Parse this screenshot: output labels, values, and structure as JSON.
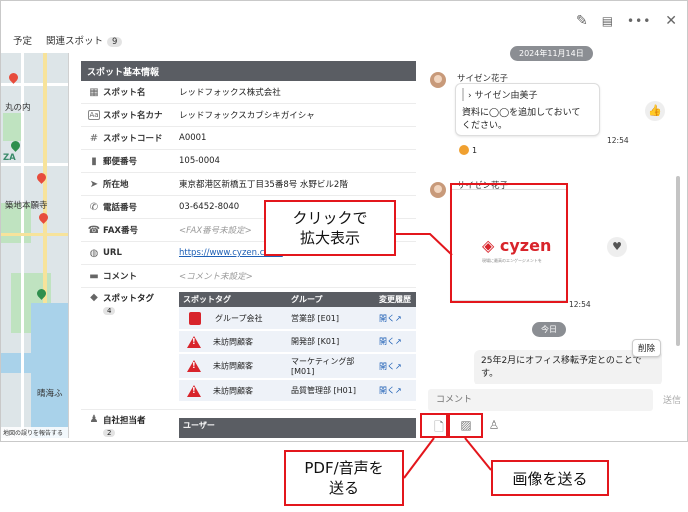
{
  "tabs": {
    "schedule": "予定",
    "related_spots": "関連スポット",
    "related_count": "9"
  },
  "map": {
    "labels": [
      "丸の内",
      "ZA",
      "築地本願寺",
      "晴海ふ"
    ],
    "report_error": "地図の誤りを報告する",
    "colors": {
      "land": "#e9eef0",
      "park": "#bfe3c0",
      "water": "#a9d2ea"
    }
  },
  "info": {
    "header": "スポット基本情報",
    "rows": [
      {
        "icon": "building-icon",
        "label": "スポット名",
        "value": "レッドフォックス株式会社"
      },
      {
        "icon": "kana-icon",
        "label": "スポット名カナ",
        "value": "レッドフォックスカブシキガイシャ"
      },
      {
        "icon": "hash-icon",
        "label": "スポットコード",
        "value": "A0001"
      },
      {
        "icon": "mailbox-icon",
        "label": "郵便番号",
        "value": "105-0004"
      },
      {
        "icon": "location-arrow-icon",
        "label": "所在地",
        "value": "東京都港区新橋五丁目35番8号 水野ビル2階"
      },
      {
        "icon": "phone-icon",
        "label": "電話番号",
        "value": "03-6452-8040"
      },
      {
        "icon": "fax-icon",
        "label": "FAX番号",
        "value": "<FAX番号未設定>"
      },
      {
        "icon": "globe-icon",
        "label": "URL",
        "value": "https://www.cyzen.cloud"
      },
      {
        "icon": "comment-icon",
        "label": "コメント",
        "value": "<コメント未設定>"
      }
    ],
    "tags": {
      "label": "スポットタグ",
      "count": "4",
      "headers": [
        "スポットタグ",
        "グループ",
        "変更履歴"
      ],
      "rows": [
        {
          "icon": "brand-icon",
          "tag": "グループ会社",
          "group": "営業部 [E01]",
          "link": "開く↗"
        },
        {
          "icon": "warning-icon",
          "tag": "未訪問顧客",
          "group": "開発部 [K01]",
          "link": "開く↗"
        },
        {
          "icon": "warning-icon",
          "tag": "未訪問顧客",
          "group": "マーケティング部 [M01]",
          "link": "開く↗"
        },
        {
          "icon": "warning-icon",
          "tag": "未訪問顧客",
          "group": "品質管理部 [H01]",
          "link": "開く↗"
        }
      ]
    },
    "owner": {
      "label": "自社担当者",
      "count": "2",
      "header": "ユーザー"
    }
  },
  "header_icons": [
    "pencil-icon",
    "chat-icon",
    "more-icon",
    "close-icon"
  ],
  "chat": {
    "date1": "2024年11月14日",
    "msg1": {
      "sender": "サイゼン花子",
      "quote": "サイゼン由美子",
      "text_line1": "資料に◯◯を追加しておいて",
      "text_line2": "ください。",
      "time": "12:54",
      "reaction_count": "1"
    },
    "msg2": {
      "sender": "サイゼン花子",
      "logo": "cyzen",
      "logo_sub": "現場に最高のエンゲージメントを",
      "time": "12:54"
    },
    "date2": "今日",
    "msg3": {
      "text_line1": "25年2月にオフィス移転予定とのことで",
      "text_line2": "す。",
      "delete_label": "削除"
    }
  },
  "composer": {
    "placeholder": "コメント",
    "send": "送信"
  },
  "callouts": {
    "enlarge_line1": "クリックで",
    "enlarge_line2": "拡大表示",
    "pdf_line1": "PDF/音声を",
    "pdf_line2": "送る",
    "image": "画像を送る",
    "color": "#e3161c"
  }
}
